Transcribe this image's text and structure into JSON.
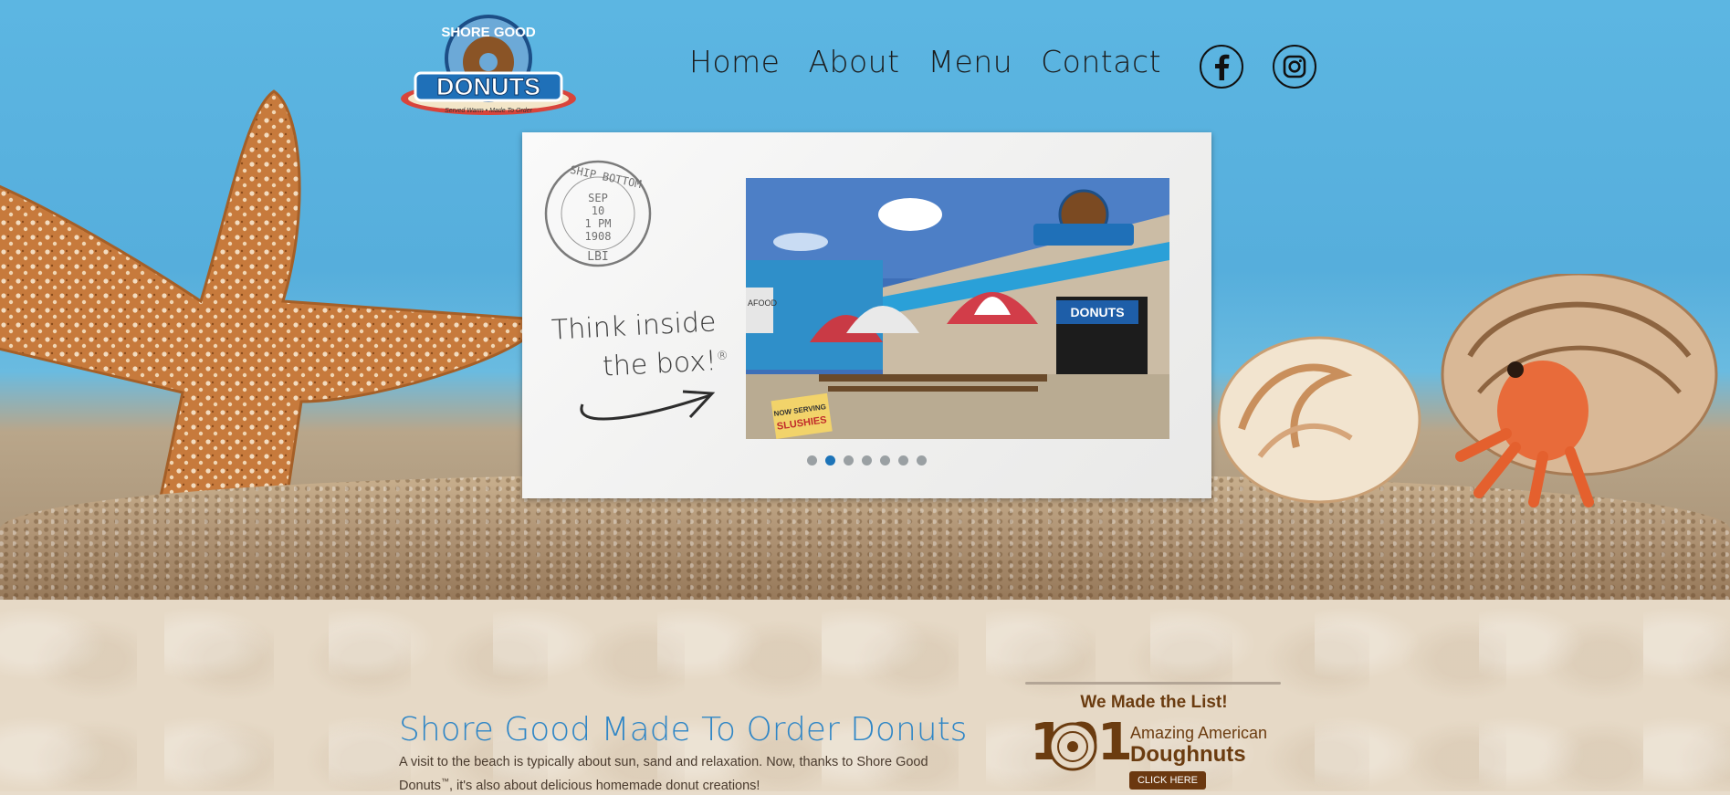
{
  "brand": {
    "logo_top": "SHORE GOOD",
    "logo_main": "DONUTS",
    "logo_sub": "Served Warm • Made To Order"
  },
  "nav": {
    "items": [
      "Home",
      "About",
      "Menu",
      "Contact"
    ]
  },
  "social": {
    "facebook": "facebook-icon",
    "instagram": "instagram-icon"
  },
  "slideshow": {
    "stamp_top": "SHIP BOTTOM",
    "stamp_lines": [
      "SEP",
      "10",
      "1 PM",
      "1908"
    ],
    "stamp_bottom": "LBI",
    "tagline_line1": "Think inside",
    "tagline_line2": "the box!",
    "tagline_mark": "®",
    "photo_sign_1": "NOW SERVING",
    "photo_sign_2": "SLUSHIES",
    "photo_building_sign": "DONUTS",
    "photo_left_sign": "AFOOD",
    "dot_count": 7,
    "active_dot": 2
  },
  "intro": {
    "headline": "Shore Good Made To Order Donuts",
    "text_before": "A visit to the beach is typically about sun, sand and relaxation. Now, thanks to Shore Good Donuts",
    "text_tm": "™",
    "text_after": ", it's also about delicious homemade donut creations!"
  },
  "award": {
    "title": "We Made the List!",
    "number": "101",
    "line1": "Amazing American",
    "line2": "Doughnuts",
    "button": "CLICK HERE"
  },
  "colors": {
    "sky": "#56aedc",
    "headline_blue": "#2f86c6",
    "brown": "#6b3c10",
    "active_dot": "#1d74b8"
  }
}
